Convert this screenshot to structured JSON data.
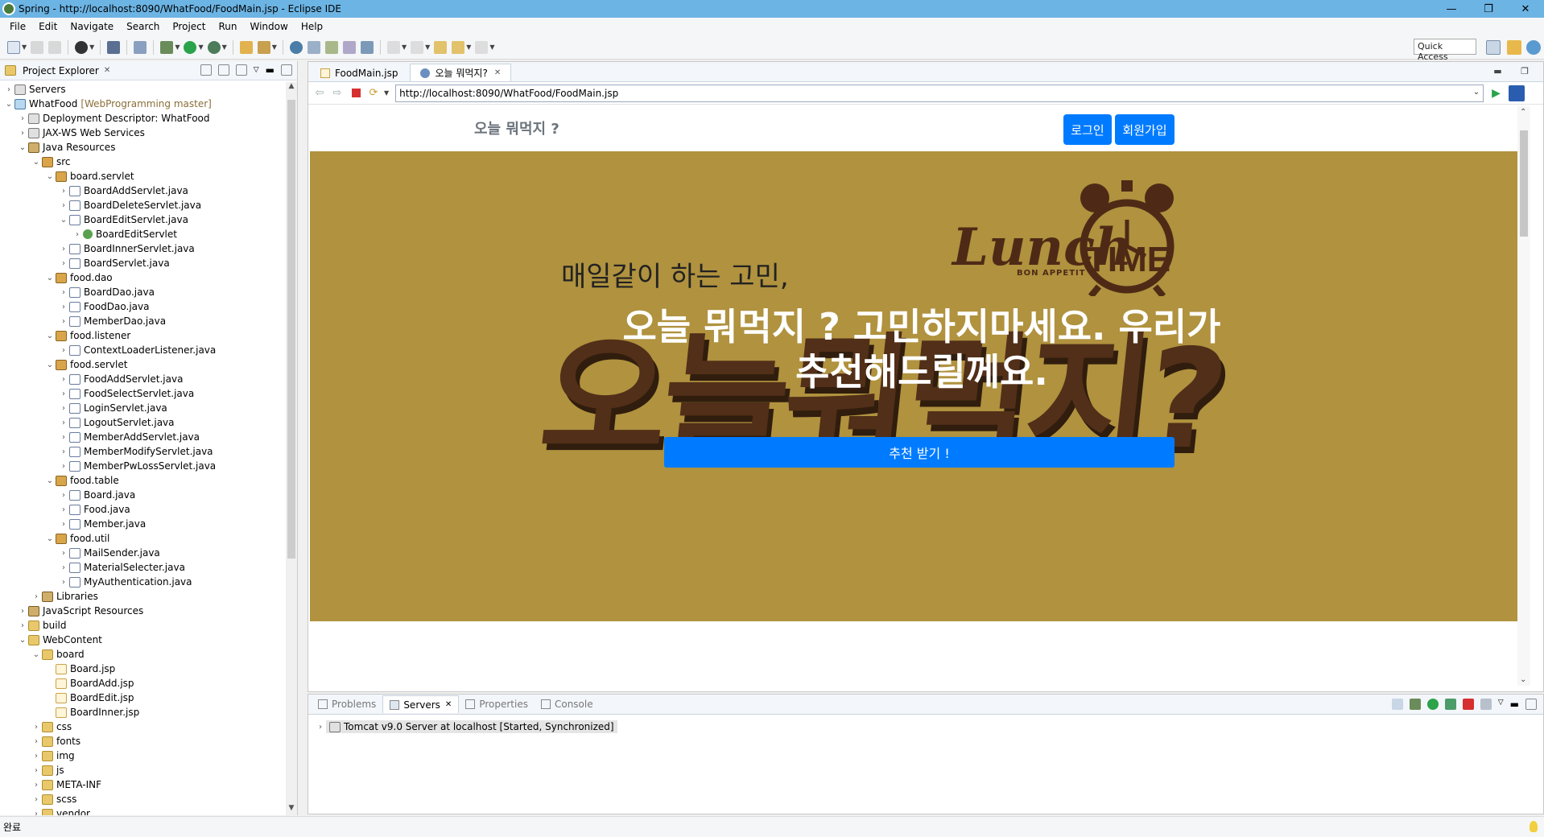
{
  "window": {
    "title": "Spring - http://localhost:8090/WhatFood/FoodMain.jsp - Eclipse IDE",
    "minimize": "—",
    "maximize": "❐",
    "close": "✕"
  },
  "menu": [
    "File",
    "Edit",
    "Navigate",
    "Search",
    "Project",
    "Run",
    "Window",
    "Help"
  ],
  "toolbar": {
    "quick_access": "Quick Access"
  },
  "explorer": {
    "title": "Project Explorer",
    "tree": [
      {
        "indent": 0,
        "twisty": "›",
        "icon": "server",
        "label": "Servers"
      },
      {
        "indent": 0,
        "twisty": "⌄",
        "icon": "proj",
        "label": "WhatFood",
        "extra": "[WebProgramming master]"
      },
      {
        "indent": 1,
        "twisty": "›",
        "icon": "server",
        "label": "Deployment Descriptor: WhatFood"
      },
      {
        "indent": 1,
        "twisty": "›",
        "icon": "server",
        "label": "JAX-WS Web Services"
      },
      {
        "indent": 1,
        "twisty": "⌄",
        "icon": "lib",
        "label": "Java Resources"
      },
      {
        "indent": 2,
        "twisty": "⌄",
        "icon": "pkg",
        "label": "src"
      },
      {
        "indent": 3,
        "twisty": "⌄",
        "icon": "pkg",
        "label": "board.servlet"
      },
      {
        "indent": 4,
        "twisty": "›",
        "icon": "java",
        "label": "BoardAddServlet.java"
      },
      {
        "indent": 4,
        "twisty": "›",
        "icon": "java",
        "label": "BoardDeleteServlet.java"
      },
      {
        "indent": 4,
        "twisty": "⌄",
        "icon": "java",
        "label": "BoardEditServlet.java"
      },
      {
        "indent": 5,
        "twisty": "›",
        "icon": "class",
        "label": "BoardEditServlet"
      },
      {
        "indent": 4,
        "twisty": "›",
        "icon": "java",
        "label": "BoardInnerServlet.java"
      },
      {
        "indent": 4,
        "twisty": "›",
        "icon": "java",
        "label": "BoardServlet.java"
      },
      {
        "indent": 3,
        "twisty": "⌄",
        "icon": "pkg",
        "label": "food.dao"
      },
      {
        "indent": 4,
        "twisty": "›",
        "icon": "java",
        "label": "BoardDao.java"
      },
      {
        "indent": 4,
        "twisty": "›",
        "icon": "java",
        "label": "FoodDao.java"
      },
      {
        "indent": 4,
        "twisty": "›",
        "icon": "java",
        "label": "MemberDao.java"
      },
      {
        "indent": 3,
        "twisty": "⌄",
        "icon": "pkg",
        "label": "food.listener"
      },
      {
        "indent": 4,
        "twisty": "›",
        "icon": "java",
        "label": "ContextLoaderListener.java"
      },
      {
        "indent": 3,
        "twisty": "⌄",
        "icon": "pkg",
        "label": "food.servlet"
      },
      {
        "indent": 4,
        "twisty": "›",
        "icon": "java",
        "label": "FoodAddServlet.java"
      },
      {
        "indent": 4,
        "twisty": "›",
        "icon": "java",
        "label": "FoodSelectServlet.java"
      },
      {
        "indent": 4,
        "twisty": "›",
        "icon": "java",
        "label": "LoginServlet.java"
      },
      {
        "indent": 4,
        "twisty": "›",
        "icon": "java",
        "label": "LogoutServlet.java"
      },
      {
        "indent": 4,
        "twisty": "›",
        "icon": "java",
        "label": "MemberAddServlet.java"
      },
      {
        "indent": 4,
        "twisty": "›",
        "icon": "java",
        "label": "MemberModifyServlet.java"
      },
      {
        "indent": 4,
        "twisty": "›",
        "icon": "java",
        "label": "MemberPwLossServlet.java"
      },
      {
        "indent": 3,
        "twisty": "⌄",
        "icon": "pkg",
        "label": "food.table"
      },
      {
        "indent": 4,
        "twisty": "›",
        "icon": "java",
        "label": "Board.java"
      },
      {
        "indent": 4,
        "twisty": "›",
        "icon": "java",
        "label": "Food.java"
      },
      {
        "indent": 4,
        "twisty": "›",
        "icon": "java",
        "label": "Member.java"
      },
      {
        "indent": 3,
        "twisty": "⌄",
        "icon": "pkg",
        "label": "food.util"
      },
      {
        "indent": 4,
        "twisty": "›",
        "icon": "java",
        "label": "MailSender.java"
      },
      {
        "indent": 4,
        "twisty": "›",
        "icon": "java",
        "label": "MaterialSelecter.java"
      },
      {
        "indent": 4,
        "twisty": "›",
        "icon": "java",
        "label": "MyAuthentication.java"
      },
      {
        "indent": 2,
        "twisty": "›",
        "icon": "lib",
        "label": "Libraries"
      },
      {
        "indent": 1,
        "twisty": "›",
        "icon": "lib",
        "label": "JavaScript Resources"
      },
      {
        "indent": 1,
        "twisty": "›",
        "icon": "folder",
        "label": "build"
      },
      {
        "indent": 1,
        "twisty": "⌄",
        "icon": "folder",
        "label": "WebContent"
      },
      {
        "indent": 2,
        "twisty": "⌄",
        "icon": "folder",
        "label": "board"
      },
      {
        "indent": 3,
        "twisty": "",
        "icon": "jsp",
        "label": "Board.jsp"
      },
      {
        "indent": 3,
        "twisty": "",
        "icon": "jsp",
        "label": "BoardAdd.jsp"
      },
      {
        "indent": 3,
        "twisty": "",
        "icon": "jsp",
        "label": "BoardEdit.jsp"
      },
      {
        "indent": 3,
        "twisty": "",
        "icon": "jsp",
        "label": "BoardInner.jsp"
      },
      {
        "indent": 2,
        "twisty": "›",
        "icon": "folder",
        "label": "css"
      },
      {
        "indent": 2,
        "twisty": "›",
        "icon": "folder",
        "label": "fonts"
      },
      {
        "indent": 2,
        "twisty": "›",
        "icon": "folder",
        "label": "img"
      },
      {
        "indent": 2,
        "twisty": "›",
        "icon": "folder",
        "label": "js"
      },
      {
        "indent": 2,
        "twisty": "›",
        "icon": "folder",
        "label": "META-INF"
      },
      {
        "indent": 2,
        "twisty": "›",
        "icon": "folder",
        "label": "scss"
      },
      {
        "indent": 2,
        "twisty": "›",
        "icon": "folder",
        "label": "vendor"
      }
    ]
  },
  "editor": {
    "tabs": [
      {
        "label": "FoodMain.jsp",
        "icon": "jsp",
        "active": false
      },
      {
        "label": "오늘 뭐먹지?",
        "icon": "globe",
        "active": true
      }
    ],
    "url": "http://localhost:8090/WhatFood/FoodMain.jsp"
  },
  "site": {
    "brand": "오늘 뭐먹지 ?",
    "login_button": "로그인",
    "signup_button": "회원가입",
    "hero_background_text": "오늘뭐먹지?",
    "logo_lunch": "Lunch",
    "logo_time": "TIME",
    "logo_bon": "BON APPETIT",
    "hero_subtitle": "매일같이 하는 고민,",
    "hero_title_line1": "오늘 뭐먹지 ? 고민하지마세요. 우리가",
    "hero_title_line2": "추천해드릴께요.",
    "cta_button": "추천 받기 !",
    "hero_color": "#b0923f",
    "button_color": "#007bff"
  },
  "bottom_panel": {
    "tabs": [
      {
        "label": "Problems",
        "active": false
      },
      {
        "label": "Servers",
        "active": true
      },
      {
        "label": "Properties",
        "active": false
      },
      {
        "label": "Console",
        "active": false
      }
    ],
    "server_row": "Tomcat v9.0 Server at localhost  [Started, Synchronized]"
  },
  "status": {
    "text": "완료"
  }
}
